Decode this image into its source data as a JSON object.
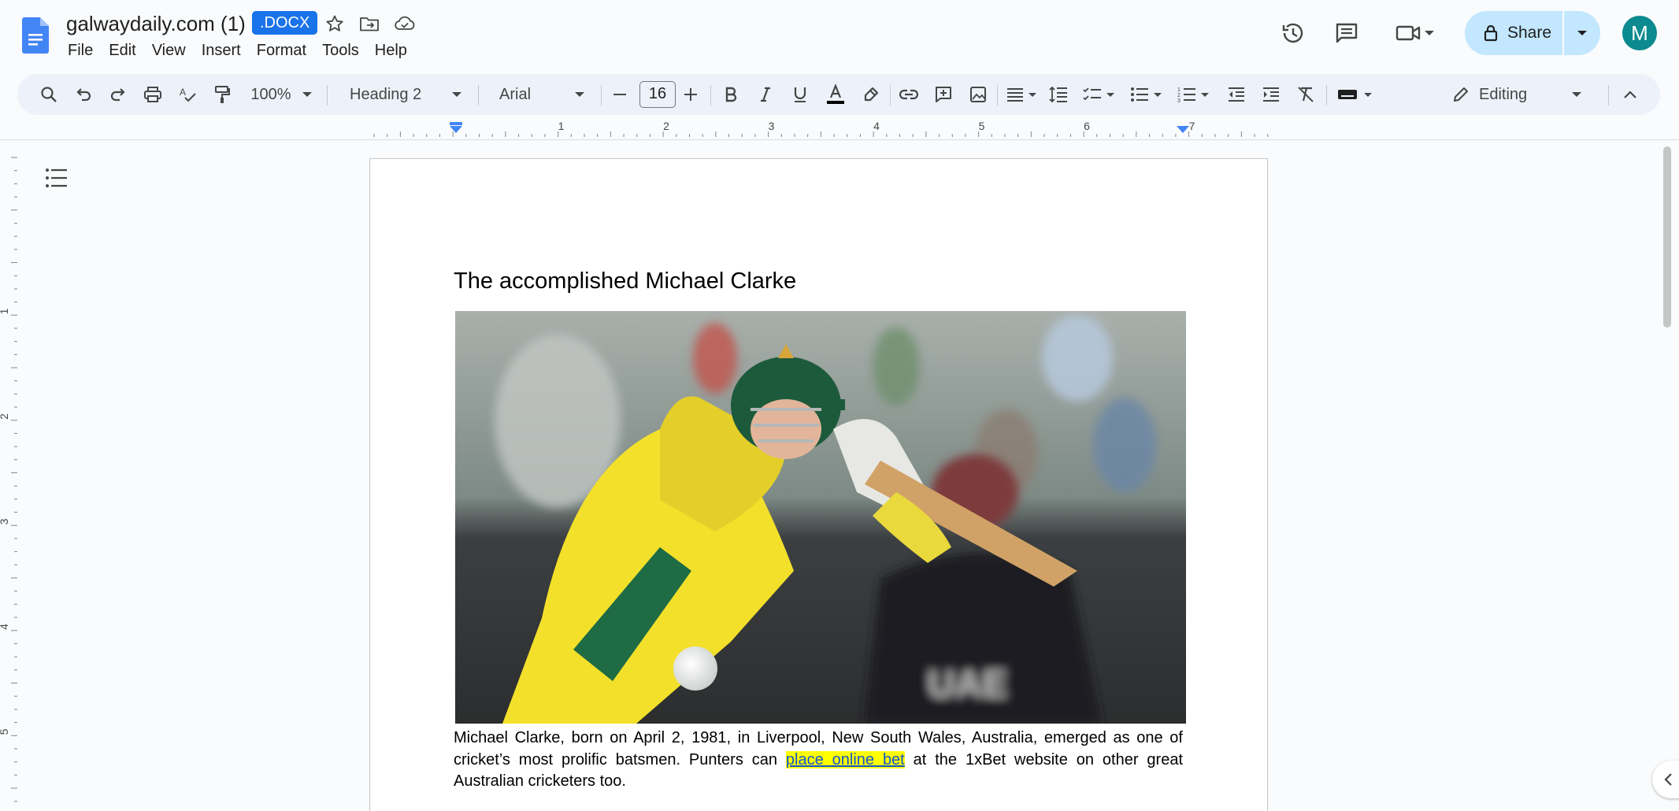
{
  "document": {
    "title": "galwaydaily.com (1)",
    "format_badge": ".DOCX"
  },
  "menu": [
    "File",
    "Edit",
    "View",
    "Insert",
    "Format",
    "Tools",
    "Help"
  ],
  "header_actions": {
    "share_label": "Share",
    "avatar_letter": "M"
  },
  "toolbar": {
    "zoom": "100%",
    "style": "Heading 2",
    "font": "Arial",
    "font_size": "16",
    "mode": "Editing"
  },
  "ruler_numbers": [
    "1",
    "2",
    "3",
    "4",
    "5",
    "6",
    "7"
  ],
  "vruler_numbers": [
    "1",
    "2",
    "3",
    "4",
    "5"
  ],
  "page": {
    "heading": "The accomplished Michael Clarke",
    "paragraph_before": "Michael Clarke, born on April 2, 1981, in Liverpool, New South Wales, Australia, emerged as one of cricket’s most prolific batsmen. Punters can ",
    "link_text": "place online bet",
    "paragraph_after": " at the 1xBet website on other great Australian cricketers too."
  },
  "colors": {
    "accent": "#1a73e8",
    "share_bg": "#c2e7ff",
    "toolbar_bg": "#edf2fa",
    "avatar": "#0b8a8f",
    "highlight": "#ffff00"
  }
}
